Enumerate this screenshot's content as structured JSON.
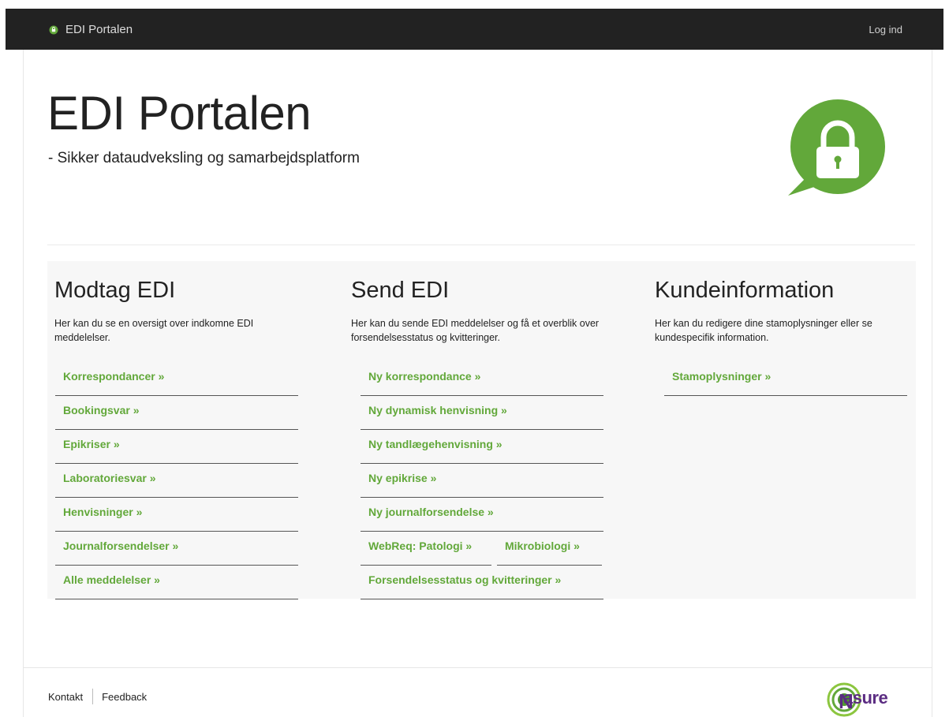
{
  "topbar": {
    "brand": "EDI Portalen",
    "login": "Log ind"
  },
  "hero": {
    "title": "EDI Portalen",
    "subtitle": "- Sikker dataudveksling og samarbejdsplatform"
  },
  "colors": {
    "accent": "#62a83a",
    "nav_bg": "#222222",
    "panel_bg": "#f7f7f7",
    "logo_purple": "#5b2c82"
  },
  "columns": [
    {
      "title": "Modtag EDI",
      "description": "Her kan du se en oversigt over indkomne EDI meddelelser.",
      "links": [
        "Korrespondancer »",
        "Bookingsvar »",
        "Epikriser »",
        "Laboratoriesvar »",
        "Henvisninger »",
        "Journalforsendelser »",
        "Alle meddelelser »"
      ]
    },
    {
      "title": "Send EDI",
      "description": "Her kan du sende EDI meddelelser og få et overblik over forsendelsesstatus og kvitteringer.",
      "links": [
        "Ny korrespondance »",
        "Ny dynamisk henvisning »",
        "Ny tandlægehenvisning »",
        "Ny epikrise »",
        "Ny journalforsendelse »",
        "WebReq: Patologi »",
        "Mikrobiologi »",
        "Forsendelsesstatus og kvitteringer »"
      ]
    },
    {
      "title": "Kundeinformation",
      "description": "Her kan du redigere dine stamoplysninger eller se kundespecifik information.",
      "links": [
        "Stamoplysninger »"
      ]
    }
  ],
  "footer": {
    "contact": "Kontakt",
    "feedback": "Feedback",
    "logo_text": "asure",
    "logo_initial": "N"
  }
}
